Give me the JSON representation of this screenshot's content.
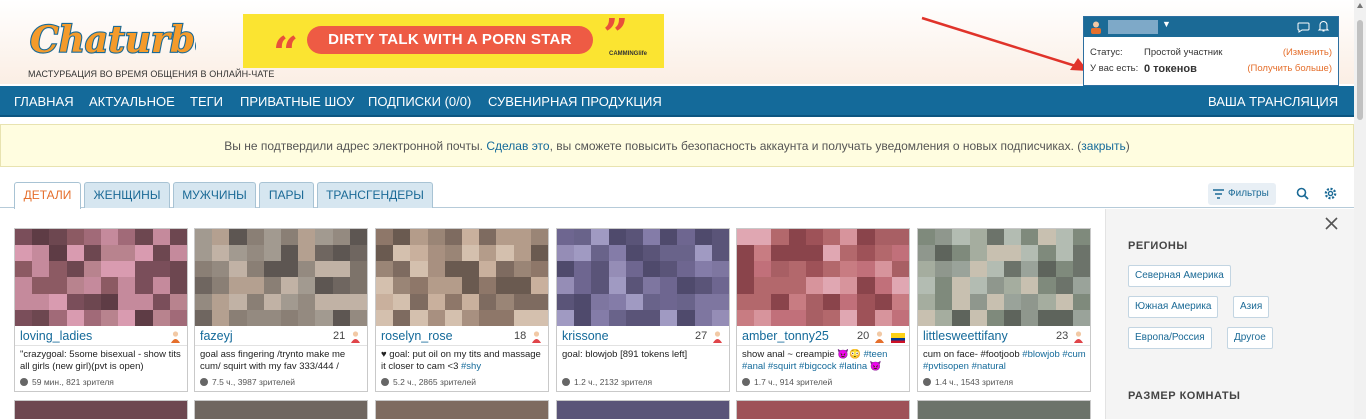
{
  "header": {
    "logo": "Chaturbate",
    "tagline": "МАСТУРБАЦИЯ ВО ВРЕМЯ ОБЩЕНИЯ В ОНЛАЙН-ЧАТЕ",
    "banner_text": "DIRTY TALK WITH A PORN STAR",
    "banner_brand": "CAMMINGlife"
  },
  "userbox": {
    "status_label": "Статус:",
    "status_value": "Простой участник",
    "change_link": "(Изменить)",
    "have_label": "У вас есть:",
    "tokens_value": "0 токенов",
    "get_more_link": "(Получить больше)"
  },
  "nav": {
    "items": [
      "ГЛАВНАЯ",
      "АКТУАЛЬНОЕ",
      "ТЕГИ",
      "ПРИВАТНЫЕ ШОУ",
      "ПОДПИСКИ (0/0)",
      "СУВЕНИРНАЯ ПРОДУКЦИЯ"
    ],
    "broadcast": "ВАША ТРАНСЛЯЦИЯ"
  },
  "alert": {
    "text_before": "Вы не подтвердили адрес электронной почты. ",
    "link_do": "Сделав это",
    "text_middle": ", вы сможете повысить безопасность аккаунта и получать уведомления о новых подписчиках. (",
    "link_close": "закрыть",
    "text_after": ")"
  },
  "tabs": [
    "ДЕТАЛИ",
    "ЖЕНЩИНЫ",
    "МУЖЧИНЫ",
    "ПАРЫ",
    "ТРАНСГЕНДЕРЫ"
  ],
  "toolbar": {
    "filters": "Фильтры"
  },
  "sidebar": {
    "regions_title": "РЕГИОНЫ",
    "regions": [
      "Северная Америка",
      "Южная Америка",
      "Азия",
      "Европа/Россия",
      "Другое"
    ],
    "room_size_title": "РАЗМЕР КОМНАТЫ"
  },
  "rooms": [
    {
      "name": "loving_ladies",
      "age": "",
      "subject": "\"crazygoal: 5some bisexual - show tits all girls (new girl)(pvt is open)",
      "tags": "",
      "stats": "59 мин., 821 зрителя",
      "gender": "couple"
    },
    {
      "name": "fazeyj",
      "age": "21",
      "subject": "goal ass fingering /trynto make me cum/ squirt with my fav 333/444 /",
      "tags": "",
      "stats": "7.5 ч., 3987 зрителей",
      "gender": "female"
    },
    {
      "name": "roselyn_rose",
      "age": "18",
      "subject": "♥ goal: put oil on my tits and massage it closer to cam <3 ",
      "tags": "#shy",
      "stats": "5.2 ч., 2865 зрителей",
      "gender": "female"
    },
    {
      "name": "krissone",
      "age": "27",
      "subject": "goal: blowjob [891 tokens left]",
      "tags": "",
      "stats": "1.2 ч., 2132 зрителя",
      "gender": "female"
    },
    {
      "name": "amber_tonny25",
      "age": "20",
      "subject": "show anal ~ creampie 😈😳 ",
      "tags": "#teen #anal #squirt #bigcock #latina 😈",
      "stats": "1.7 ч., 914 зрителей",
      "gender": "couple",
      "flag": "colombia"
    },
    {
      "name": "littlesweettifany",
      "age": "23",
      "subject": "cum on face- #footjoob ",
      "tags": "#blowjob #cum #pvtisopen #natural",
      "stats": "1.4 ч., 1543 зрителя",
      "gender": "female"
    }
  ]
}
